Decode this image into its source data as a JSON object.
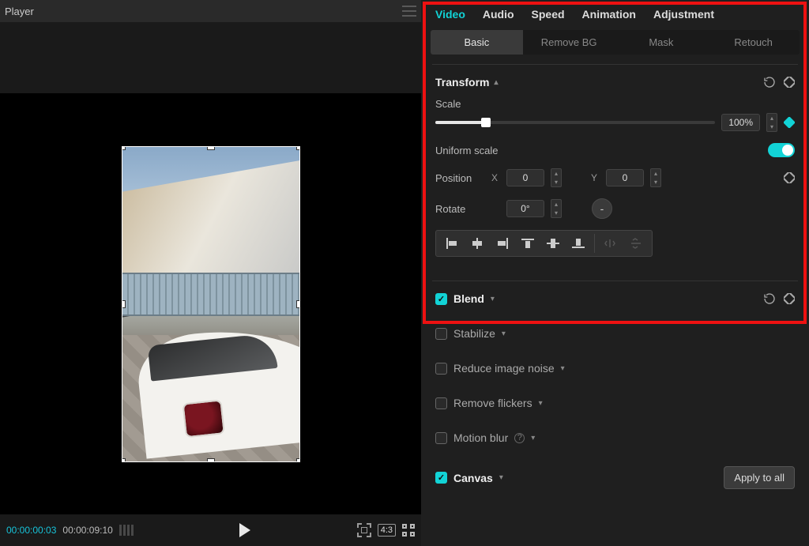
{
  "player": {
    "title": "Player",
    "time_current": "00:00:00:03",
    "time_total": "00:00:09:10",
    "aspect": "4:3"
  },
  "tabs": {
    "main": [
      "Video",
      "Audio",
      "Speed",
      "Animation",
      "Adjustment"
    ],
    "main_active": 0,
    "sub": [
      "Basic",
      "Remove BG",
      "Mask",
      "Retouch"
    ],
    "sub_active": 0
  },
  "transform": {
    "title": "Transform",
    "scale_label": "Scale",
    "scale_value": "100%",
    "uniform_label": "Uniform scale",
    "uniform_on": true,
    "position_label": "Position",
    "pos_x_label": "X",
    "pos_x": "0",
    "pos_y_label": "Y",
    "pos_y": "0",
    "rotate_label": "Rotate",
    "rotate_value": "0°"
  },
  "sections": {
    "blend": "Blend",
    "stabilize": "Stabilize",
    "reduce_noise": "Reduce image noise",
    "remove_flickers": "Remove flickers",
    "motion_blur": "Motion blur",
    "canvas": "Canvas"
  },
  "apply_all": "Apply to all"
}
